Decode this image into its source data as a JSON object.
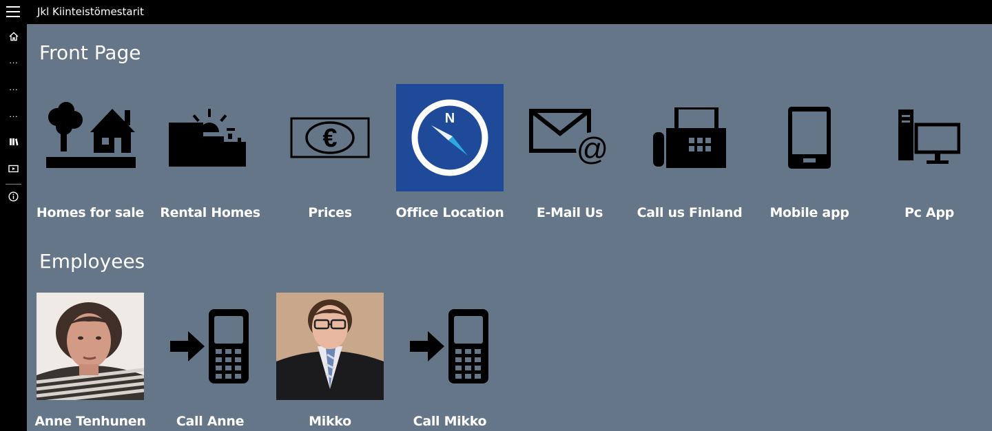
{
  "app": {
    "title": "Jkl Kiinteistömestarit"
  },
  "sidebar": {
    "items": [
      {
        "icon": "home-icon"
      },
      {
        "icon": "more-icon",
        "label": "···"
      },
      {
        "icon": "more-icon",
        "label": "···"
      },
      {
        "icon": "more-icon",
        "label": "···"
      },
      {
        "icon": "library-icon"
      },
      {
        "icon": "video-icon"
      },
      {
        "icon": "info-icon"
      }
    ]
  },
  "front_page": {
    "title": "Front Page",
    "tiles": [
      {
        "label": "Homes for sale",
        "icon": "house-tree-icon"
      },
      {
        "label": "Rental Homes",
        "icon": "rental-sun-icon"
      },
      {
        "label": "Prices",
        "icon": "euro-banknote-icon"
      },
      {
        "label": "Office Location",
        "icon": "compass-icon",
        "accent": "#1f4a9a"
      },
      {
        "label": "E-Mail Us",
        "icon": "email-icon"
      },
      {
        "label": "Call us Finland",
        "icon": "fax-phone-icon"
      },
      {
        "label": "Mobile app",
        "icon": "mobile-icon"
      },
      {
        "label": "Pc App",
        "icon": "pc-icon"
      }
    ]
  },
  "employees": {
    "title": "Employees",
    "tiles": [
      {
        "label": "Anne Tenhunen",
        "icon": "employee-photo-anne"
      },
      {
        "label": "Call Anne",
        "icon": "call-phone-icon"
      },
      {
        "label": "Mikko",
        "icon": "employee-photo-mikko"
      },
      {
        "label": "Call Mikko",
        "icon": "call-phone-icon"
      }
    ]
  },
  "colors": {
    "background": "#657688",
    "bar": "#000000",
    "compass_tile": "#1f4a9a"
  }
}
